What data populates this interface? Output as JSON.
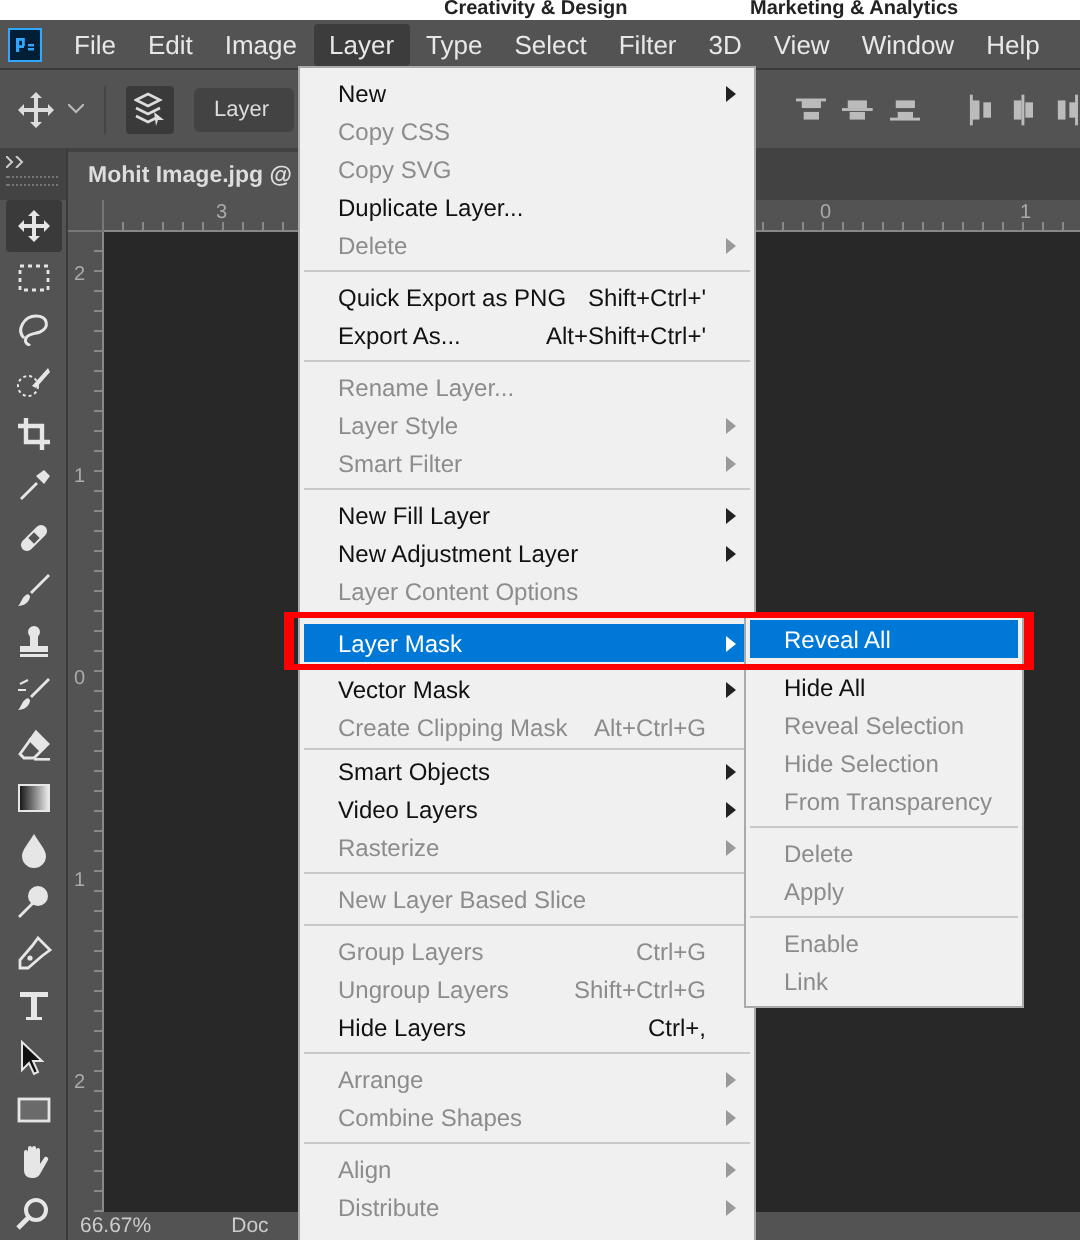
{
  "top_strip": {
    "links": [
      "Creativity & Design",
      "Marketing & Analytics"
    ]
  },
  "menu_bar": {
    "items": [
      {
        "label": "File",
        "selected": false
      },
      {
        "label": "Edit",
        "selected": false
      },
      {
        "label": "Image",
        "selected": false
      },
      {
        "label": "Layer",
        "selected": true
      },
      {
        "label": "Type",
        "selected": false
      },
      {
        "label": "Select",
        "selected": false
      },
      {
        "label": "Filter",
        "selected": false
      },
      {
        "label": "3D",
        "selected": false
      },
      {
        "label": "View",
        "selected": false
      },
      {
        "label": "Window",
        "selected": false
      },
      {
        "label": "Help",
        "selected": false
      }
    ]
  },
  "options_bar": {
    "dropdown": "Layer"
  },
  "document_tab": {
    "title": "Mohit Image.jpg @"
  },
  "rulers": {
    "horizontal": [
      "3",
      "0",
      "1"
    ],
    "vertical": [
      "2",
      "1",
      "0",
      "1",
      "2"
    ]
  },
  "status_bar": {
    "zoom": "66.67%",
    "info": "Doc"
  },
  "layer_menu": {
    "groups": [
      [
        {
          "label": "New",
          "disabled": false,
          "submenu": true,
          "selected": false
        },
        {
          "label": "Copy CSS",
          "disabled": true,
          "submenu": false,
          "selected": false
        },
        {
          "label": "Copy SVG",
          "disabled": true,
          "submenu": false,
          "selected": false
        },
        {
          "label": "Duplicate Layer...",
          "disabled": false,
          "submenu": false,
          "selected": false
        },
        {
          "label": "Delete",
          "disabled": true,
          "submenu": true,
          "selected": false
        }
      ],
      [
        {
          "label": "Quick Export as PNG",
          "shortcut": "Shift+Ctrl+'",
          "disabled": false,
          "submenu": false,
          "selected": false
        },
        {
          "label": "Export As...",
          "shortcut": "Alt+Shift+Ctrl+'",
          "disabled": false,
          "submenu": false,
          "selected": false
        }
      ],
      [
        {
          "label": "Rename Layer...",
          "disabled": true,
          "submenu": false,
          "selected": false
        },
        {
          "label": "Layer Style",
          "disabled": true,
          "submenu": true,
          "selected": false
        },
        {
          "label": "Smart Filter",
          "disabled": true,
          "submenu": true,
          "selected": false
        }
      ],
      [
        {
          "label": "New Fill Layer",
          "disabled": false,
          "submenu": true,
          "selected": false
        },
        {
          "label": "New Adjustment Layer",
          "disabled": false,
          "submenu": true,
          "selected": false
        },
        {
          "label": "Layer Content Options",
          "disabled": true,
          "submenu": false,
          "selected": false
        }
      ],
      [
        {
          "label": "Layer Mask",
          "disabled": false,
          "submenu": true,
          "selected": true
        },
        {
          "label": "Vector Mask",
          "disabled": false,
          "submenu": true,
          "selected": false
        },
        {
          "label": "Create Clipping Mask",
          "shortcut": "Alt+Ctrl+G",
          "disabled": true,
          "submenu": false,
          "selected": false
        }
      ],
      [
        {
          "label": "Smart Objects",
          "disabled": false,
          "submenu": true,
          "selected": false
        },
        {
          "label": "Video Layers",
          "disabled": false,
          "submenu": true,
          "selected": false
        },
        {
          "label": "Rasterize",
          "disabled": true,
          "submenu": true,
          "selected": false
        }
      ],
      [
        {
          "label": "New Layer Based Slice",
          "disabled": true,
          "submenu": false,
          "selected": false
        }
      ],
      [
        {
          "label": "Group Layers",
          "shortcut": "Ctrl+G",
          "disabled": true,
          "submenu": false,
          "selected": false
        },
        {
          "label": "Ungroup Layers",
          "shortcut": "Shift+Ctrl+G",
          "disabled": true,
          "submenu": false,
          "selected": false
        },
        {
          "label": "Hide Layers",
          "shortcut": "Ctrl+,",
          "disabled": false,
          "submenu": false,
          "selected": false
        }
      ],
      [
        {
          "label": "Arrange",
          "disabled": true,
          "submenu": true,
          "selected": false
        },
        {
          "label": "Combine Shapes",
          "disabled": true,
          "submenu": true,
          "selected": false
        }
      ],
      [
        {
          "label": "Align",
          "disabled": true,
          "submenu": true,
          "selected": false
        },
        {
          "label": "Distribute",
          "disabled": true,
          "submenu": true,
          "selected": false
        }
      ]
    ]
  },
  "layer_mask_submenu": {
    "groups": [
      [
        {
          "label": "Reveal All",
          "disabled": false,
          "selected": true
        },
        {
          "label": "Hide All",
          "disabled": false,
          "selected": false
        },
        {
          "label": "Reveal Selection",
          "disabled": true,
          "selected": false
        },
        {
          "label": "Hide Selection",
          "disabled": true,
          "selected": false
        },
        {
          "label": "From Transparency",
          "disabled": true,
          "selected": false
        }
      ],
      [
        {
          "label": "Delete",
          "disabled": true,
          "selected": false
        },
        {
          "label": "Apply",
          "disabled": true,
          "selected": false
        }
      ],
      [
        {
          "label": "Enable",
          "disabled": true,
          "selected": false
        },
        {
          "label": "Link",
          "disabled": true,
          "selected": false
        }
      ]
    ]
  }
}
